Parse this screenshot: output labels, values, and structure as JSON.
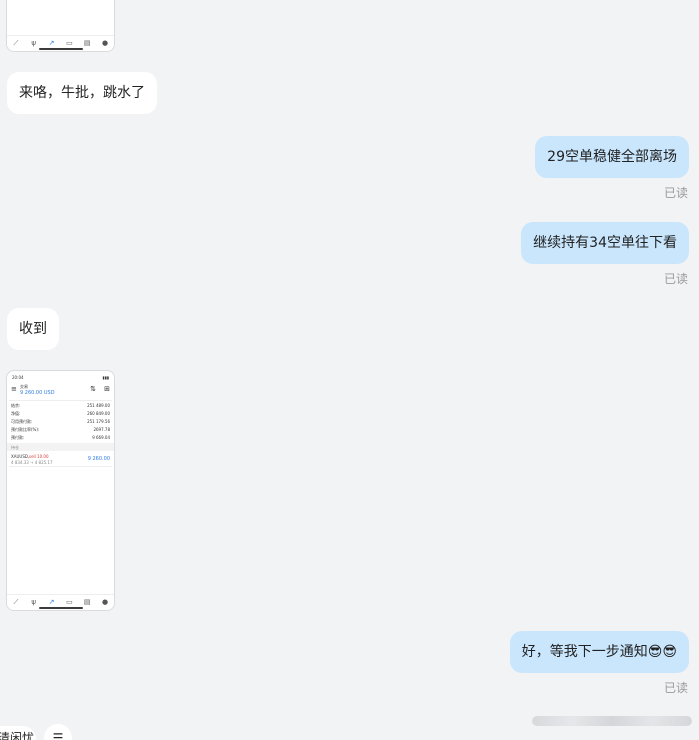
{
  "messages": [
    {
      "id": "m1",
      "side": "in",
      "text": "来咯，牛批，跳水了"
    },
    {
      "id": "m2",
      "side": "out",
      "text": "29空单稳健全部离场",
      "status": "已读"
    },
    {
      "id": "m3",
      "side": "out",
      "text": "继续持有34空单往下看",
      "status": "已读"
    },
    {
      "id": "m4",
      "side": "in",
      "text": "收到"
    },
    {
      "id": "m5",
      "side": "out",
      "text": "好，等我下一步通知😎😎",
      "status": "已读"
    }
  ],
  "screenshot": {
    "status_time": "20:04",
    "status_right": "▮▮▮",
    "header_title": "交易",
    "balance_display": "9 260.00 USD",
    "rows": [
      {
        "label": "结余:",
        "value": "251 489.00"
      },
      {
        "label": "净值:",
        "value": "260 849.00"
      },
      {
        "label": "可用预付款:",
        "value": "251 179.56"
      },
      {
        "label": "预付款比率(%):",
        "value": "2697.78"
      },
      {
        "label": "预付款:",
        "value": "9 669.04"
      }
    ],
    "section_label": "持仓",
    "position": {
      "symbol": "XAUUSD,",
      "side_qty": "sell 10.00",
      "prices": "4 834.33 → 4 825.17",
      "profit": "9 260.00"
    }
  },
  "bottom": {
    "left_text": "清闲忧",
    "menu_glyph": "☰"
  },
  "colors": {
    "background": "#f2f3f5",
    "incoming_bubble": "#ffffff",
    "outgoing_bubble": "#c9e6fd",
    "read_text": "#9a9a9a",
    "accent_blue": "#2f7de1"
  }
}
